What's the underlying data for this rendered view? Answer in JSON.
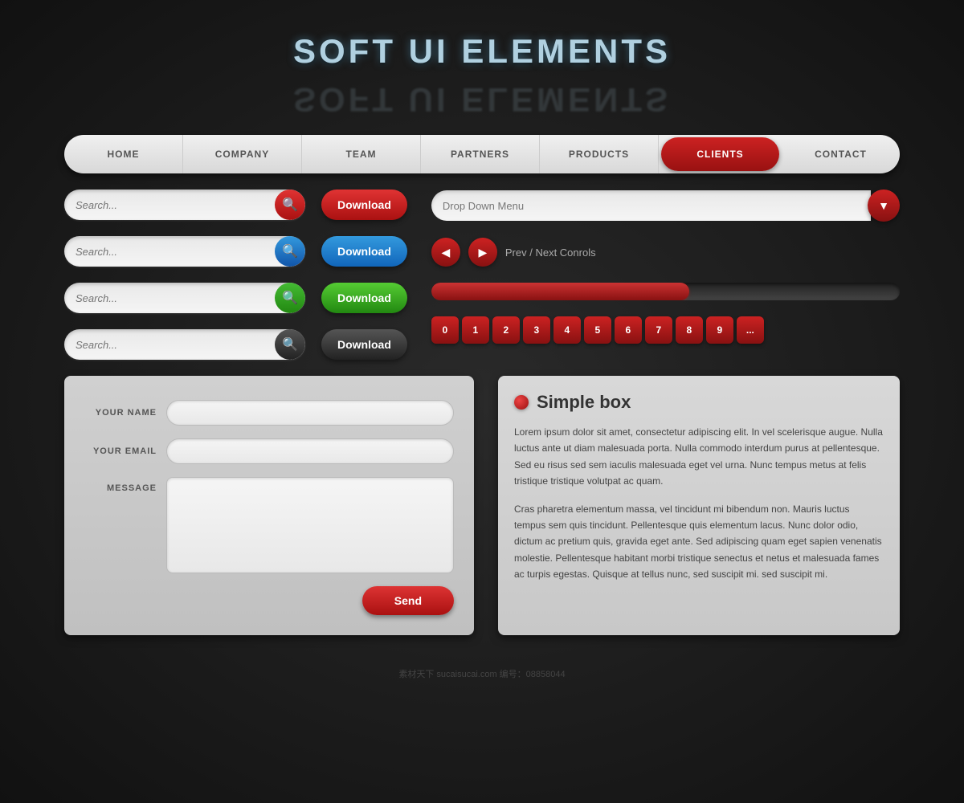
{
  "title": {
    "main": "SOFT UI ELEMENTS",
    "reflection": "SOFT UI ELEMENTS"
  },
  "nav": {
    "items": [
      "HOME",
      "COMPANY",
      "TEAM",
      "PARTNERS",
      "PRODUCTS",
      "CLIENTS",
      "CONTACT"
    ],
    "active": "CLIENTS"
  },
  "search_bars": [
    {
      "placeholder": "Search...",
      "button_style": "red"
    },
    {
      "placeholder": "Search...",
      "button_style": "blue"
    },
    {
      "placeholder": "Search...",
      "button_style": "green"
    },
    {
      "placeholder": "Search...",
      "button_style": "dark"
    }
  ],
  "download_buttons": [
    {
      "label": "Download",
      "style": "red"
    },
    {
      "label": "Download",
      "style": "blue"
    },
    {
      "label": "Download",
      "style": "green"
    },
    {
      "label": "Download",
      "style": "dark"
    }
  ],
  "dropdown": {
    "placeholder": "Drop Down Menu"
  },
  "prev_next": {
    "label": "Prev / Next Conrols"
  },
  "progress": {
    "value": 55
  },
  "pagination": {
    "items": [
      "0",
      "1",
      "2",
      "3",
      "4",
      "5",
      "6",
      "7",
      "8",
      "9",
      "..."
    ]
  },
  "form": {
    "name_label": "YOUR NAME",
    "email_label": "YOUR EMAIL",
    "message_label": "MESSAGE",
    "send_label": "Send",
    "name_placeholder": "",
    "email_placeholder": "",
    "message_placeholder": ""
  },
  "simple_box": {
    "title": "Simple box",
    "paragraph1": "Lorem ipsum dolor sit amet, consectetur adipiscing elit. In vel scelerisque augue. Nulla luctus ante ut diam malesuada porta. Nulla commodo interdum purus at pellentesque. Sed eu risus sed sem iaculis malesuada eget vel urna. Nunc tempus metus at felis tristique tristique volutpat ac quam.",
    "paragraph2": "Cras pharetra elementum massa, vel tincidunt mi bibendum non. Mauris luctus tempus sem quis tincidunt. Pellentesque quis elementum lacus. Nunc dolor odio, dictum ac pretium quis, gravida eget ante. Sed adipiscing quam eget sapien venenatis molestie. Pellentesque habitant morbi tristique senectus et netus et malesuada fames ac turpis egestas. Quisque at tellus nunc, sed suscipit mi. sed suscipit mi."
  },
  "watermark": "素材天下 sucaisucai.com  编号：08858044"
}
